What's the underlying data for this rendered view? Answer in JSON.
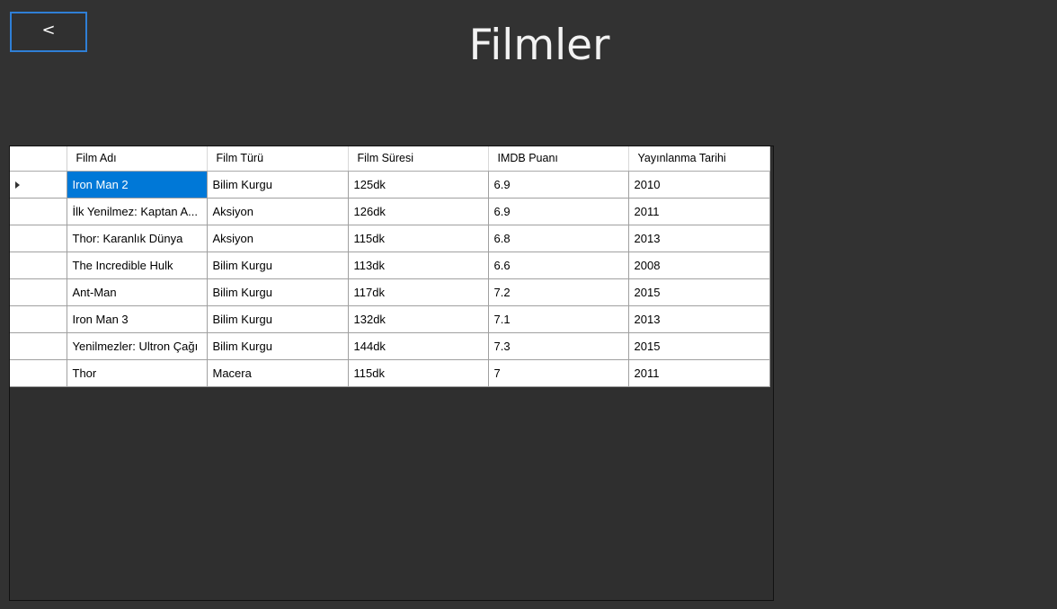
{
  "header": {
    "back_label": "<",
    "title": "Filmler"
  },
  "grid": {
    "columns": [
      "Film Adı",
      "Film Türü",
      "Film Süresi",
      "IMDB Puanı",
      "Yayınlanma Tarihi"
    ],
    "rows": [
      [
        "Iron Man 2",
        "Bilim Kurgu",
        "125dk",
        "6.9",
        "2010"
      ],
      [
        "İlk Yenilmez: Kaptan A...",
        "Aksiyon",
        "126dk",
        "6.9",
        "2011"
      ],
      [
        "Thor: Karanlık Dünya",
        "Aksiyon",
        "115dk",
        "6.8",
        "2013"
      ],
      [
        "The Incredible Hulk",
        "Bilim Kurgu",
        "113dk",
        "6.6",
        "2008"
      ],
      [
        "Ant-Man",
        "Bilim Kurgu",
        "117dk",
        "7.2",
        "2015"
      ],
      [
        "Iron Man 3",
        "Bilim Kurgu",
        "132dk",
        "7.1",
        "2013"
      ],
      [
        "Yenilmezler: Ultron Çağı",
        "Bilim Kurgu",
        "144dk",
        "7.3",
        "2015"
      ],
      [
        "Thor",
        "Macera",
        "115dk",
        "7",
        "2011"
      ]
    ],
    "current_row_index": 0,
    "row_pointer_icon": "triangle-right-icon"
  },
  "colors": {
    "background": "#323232",
    "selection": "#0078d7",
    "focus_border": "#2f7fd6"
  }
}
